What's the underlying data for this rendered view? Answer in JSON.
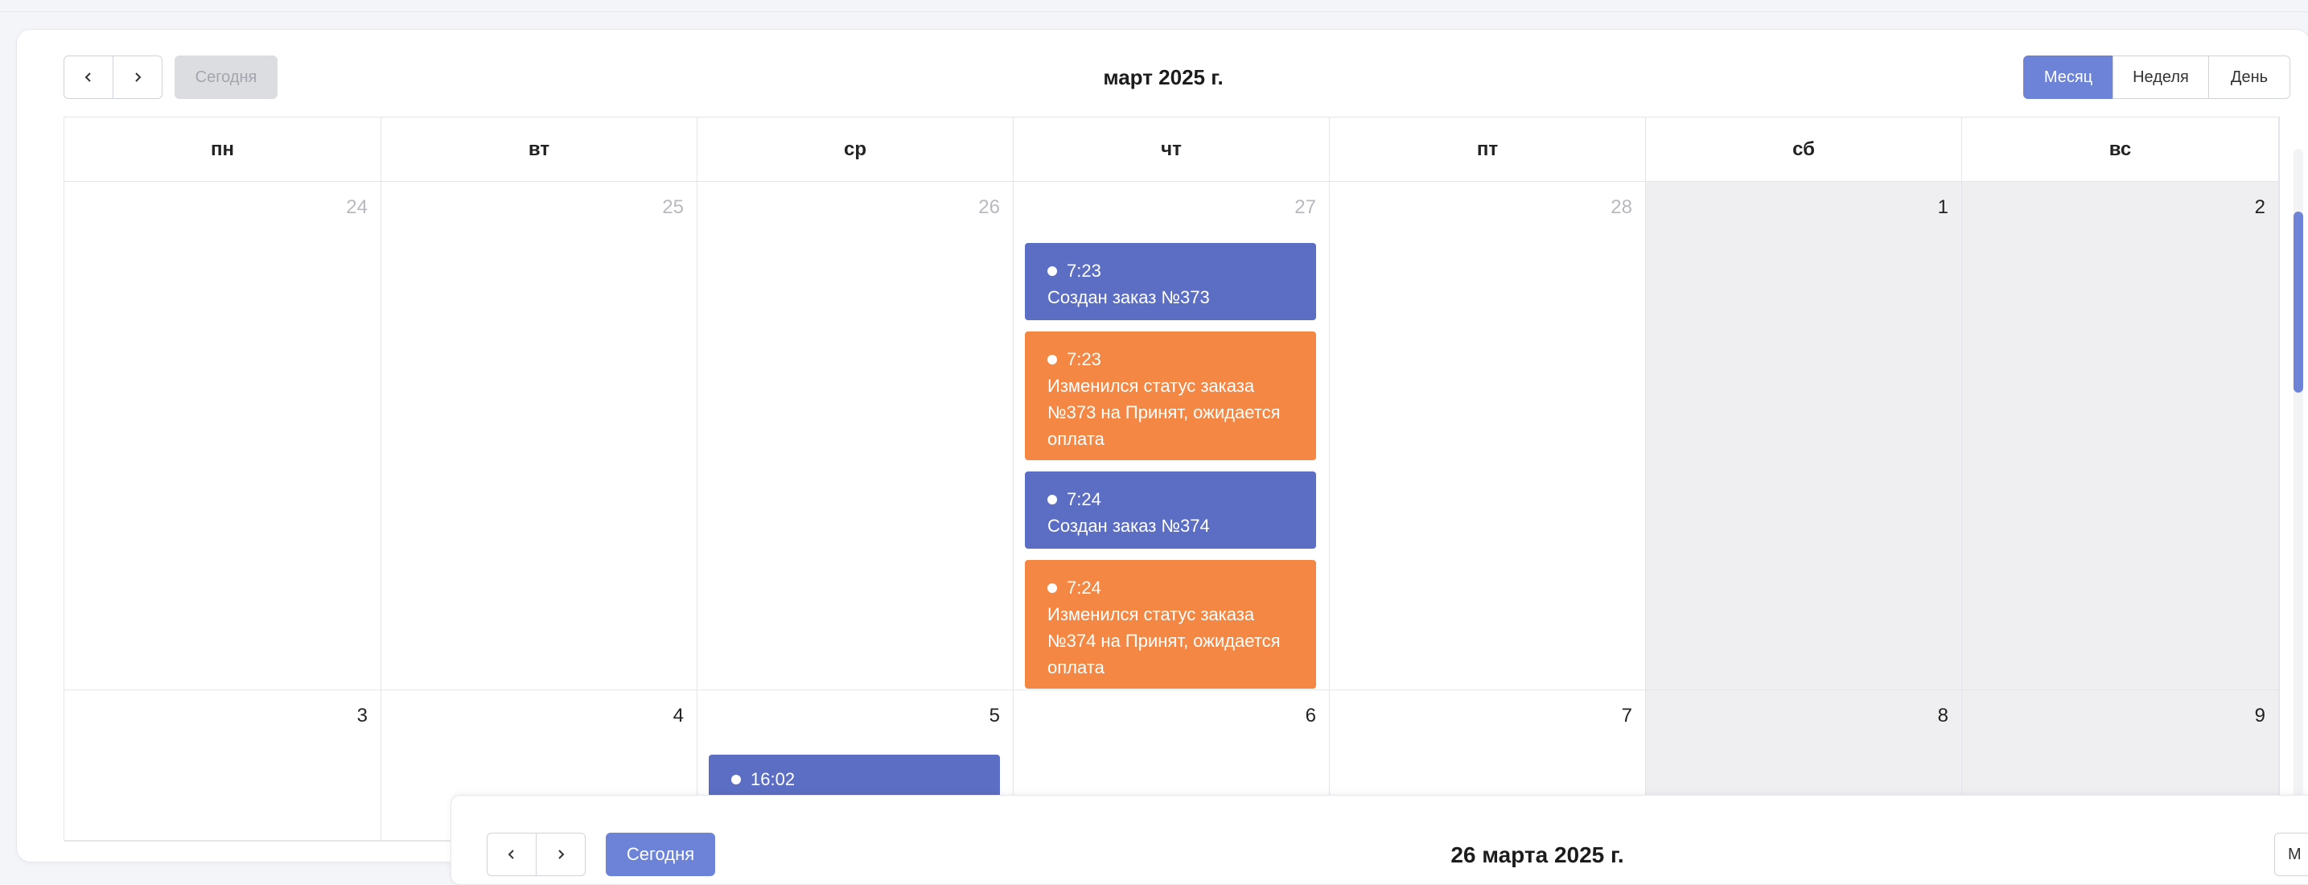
{
  "toolbar": {
    "today_label": "Сегодня",
    "title": "март 2025 г.",
    "views": {
      "month": "Месяц",
      "week": "Неделя",
      "day": "День"
    }
  },
  "weekdays": [
    "пн",
    "вт",
    "ср",
    "чт",
    "пт",
    "сб",
    "вс"
  ],
  "week1": {
    "days": [
      "24",
      "25",
      "26",
      "27",
      "28",
      "1",
      "2"
    ],
    "events": [
      {
        "time": "7:23",
        "title": "Создан заказ №373",
        "color": "#5c6ec4"
      },
      {
        "time": "7:23",
        "title": "Изменился статус заказа №373 на Принят, ожидается оплата",
        "color": "#f38743"
      },
      {
        "time": "7:24",
        "title": "Создан заказ №374",
        "color": "#5c6ec4"
      },
      {
        "time": "7:24",
        "title": "Изменился статус заказа №374 на Принят, ожидается оплата",
        "color": "#f38743"
      }
    ]
  },
  "week2": {
    "days": [
      "3",
      "4",
      "5",
      "6",
      "7",
      "8",
      "9"
    ],
    "events": [
      {
        "time": "16:02",
        "color": "#5c6ec4"
      }
    ]
  },
  "panel2": {
    "today_label": "Сегодня",
    "title": "26 марта 2025 г.",
    "view_partial": "М"
  },
  "colors": {
    "accent": "#6c83d8",
    "event_blue": "#5c6ec4",
    "event_orange": "#f38743",
    "weekend_bg": "#efeff1"
  }
}
